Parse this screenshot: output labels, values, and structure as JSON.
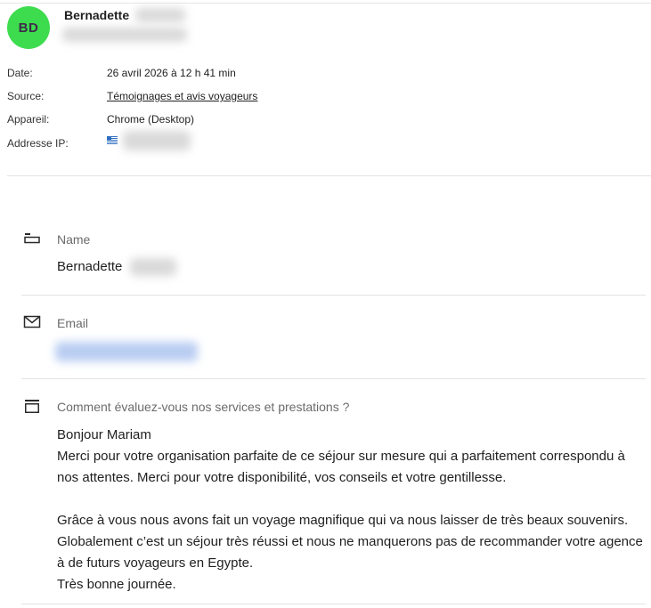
{
  "header": {
    "avatar_initials": "BD",
    "avatar_color": "#3ddc4e",
    "sender_name": "Bernadette"
  },
  "meta": {
    "date_label": "Date:",
    "date_value": "26 avril 2026 à 12 h 41 min",
    "source_label": "Source:",
    "source_value": "Témoignages et avis voyageurs",
    "device_label": "Appareil:",
    "device_value": "Chrome (Desktop)",
    "ip_label": "Addresse IP:",
    "ip_flag_icon": "greece-flag-icon"
  },
  "fields": {
    "name_label": "Name",
    "name_value": "Bernadette",
    "email_label": "Email",
    "question_label": "Comment évaluez-vous nos services et prestations ?",
    "message": "Bonjour Mariam\nMerci pour votre organisation parfaite de ce séjour sur mesure qui a parfaitement correspondu à nos attentes. Merci pour votre disponibilité, vos conseils et votre gentillesse.\n\nGrâce à vous nous avons fait un voyage magnifique qui va nous laisser de très beaux souvenirs. Globalement c’est un séjour très réussi et nous ne manquerons pas de recommander votre agence à de futurs voyageurs en Egypte.\nTrès bonne journée."
  },
  "icons": {
    "name": "name-field-icon",
    "email": "envelope-icon",
    "question": "textarea-field-icon"
  }
}
